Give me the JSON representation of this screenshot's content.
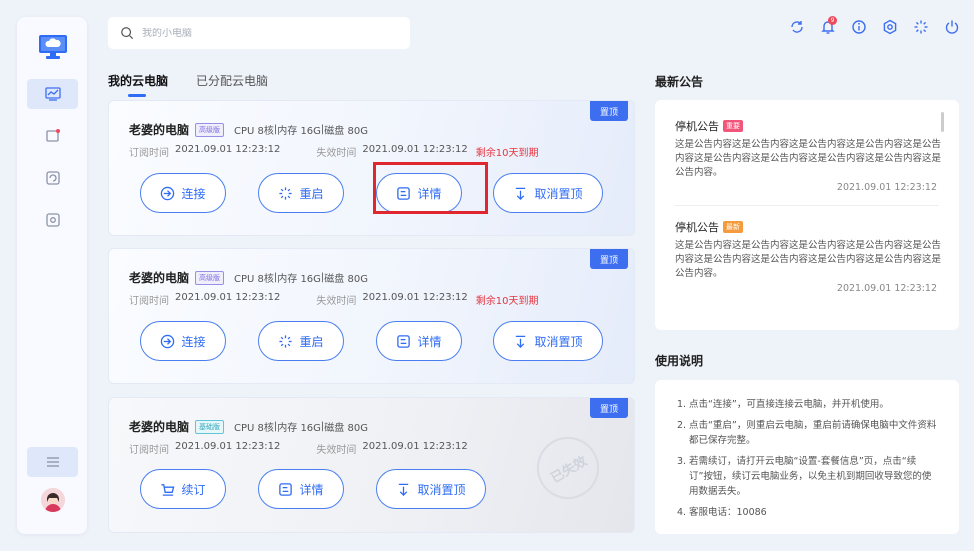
{
  "search": {
    "placeholder": "我的小电脑"
  },
  "tabs": [
    {
      "label": "我的云电脑"
    },
    {
      "label": "已分配云电脑"
    }
  ],
  "cards": [
    {
      "pin": "置顶",
      "name": "老婆的电脑",
      "tier": "高级版",
      "cpu": "CPU 8核",
      "mem": "内存 16G",
      "disk": "磁盘 80G",
      "subscribe_label": "订阅时间",
      "subscribe_time": "2021.09.01 12:23:12",
      "expire_label": "失效时间",
      "expire_time": "2021.09.01 12:23:12",
      "remaining": "剩余10天到期",
      "buttons": {
        "connect": "连接",
        "restart": "重启",
        "details": "详情",
        "unpin": "取消置顶"
      }
    },
    {
      "pin": "置顶",
      "name": "老婆的电脑",
      "tier": "高级版",
      "cpu": "CPU 8核",
      "mem": "内存 16G",
      "disk": "磁盘 80G",
      "subscribe_label": "订阅时间",
      "subscribe_time": "2021.09.01 12:23:12",
      "expire_label": "失效时间",
      "expire_time": "2021.09.01 12:23:12",
      "remaining": "剩余10天到期",
      "buttons": {
        "connect": "连接",
        "restart": "重启",
        "details": "详情",
        "unpin": "取消置顶"
      }
    },
    {
      "pin": "置顶",
      "name": "老婆的电脑",
      "tier": "基础版",
      "cpu": "CPU 8核",
      "mem": "内存 16G",
      "disk": "磁盘 80G",
      "subscribe_label": "订阅时间",
      "subscribe_time": "2021.09.01 12:23:12",
      "expire_label": "失效时间",
      "expire_time": "2021.09.01 12:23:12",
      "stamp": "已失效",
      "buttons": {
        "renew": "续订",
        "details": "详情",
        "unpin": "取消置顶"
      }
    }
  ],
  "announcements": {
    "title": "最新公告",
    "items": [
      {
        "title": "停机公告",
        "tag": "重要",
        "body": "这是公告内容这是公告内容这是公告内容这是公告内容这是公告内容这是公告内容这是公告内容这是公告内容这是公告内容这是公告内容。",
        "time": "2021.09.01 12:23:12"
      },
      {
        "title": "停机公告",
        "tag": "最新",
        "body": "这是公告内容这是公告内容这是公告内容这是公告内容这是公告内容这是公告内容这是公告内容这是公告内容这是公告内容这是公告内容。",
        "time": "2021.09.01 12:23:12"
      }
    ]
  },
  "guide": {
    "title": "使用说明",
    "items": [
      {
        "num": "1.",
        "text": "点击“连接”，可直接连接云电脑，并开机使用。"
      },
      {
        "num": "2.",
        "text": "点击“重启”，则重启云电脑，重启前请确保电脑中文件资料都已保存完整。"
      },
      {
        "num": "3.",
        "text": "若需续订，请打开云电脑“设置-套餐信息”页，点击“续订”按钮，续订云电脑业务，以免主机到期回收导致您的使用数据丢失。"
      },
      {
        "num": "4.",
        "text": "客服电话：10086"
      }
    ]
  },
  "notifications": {
    "count": "9"
  },
  "colors": {
    "accent": "#2f6cf5",
    "warning": "#e6343f",
    "pin": "#3d6ef0",
    "highlight": "#e0262f"
  }
}
